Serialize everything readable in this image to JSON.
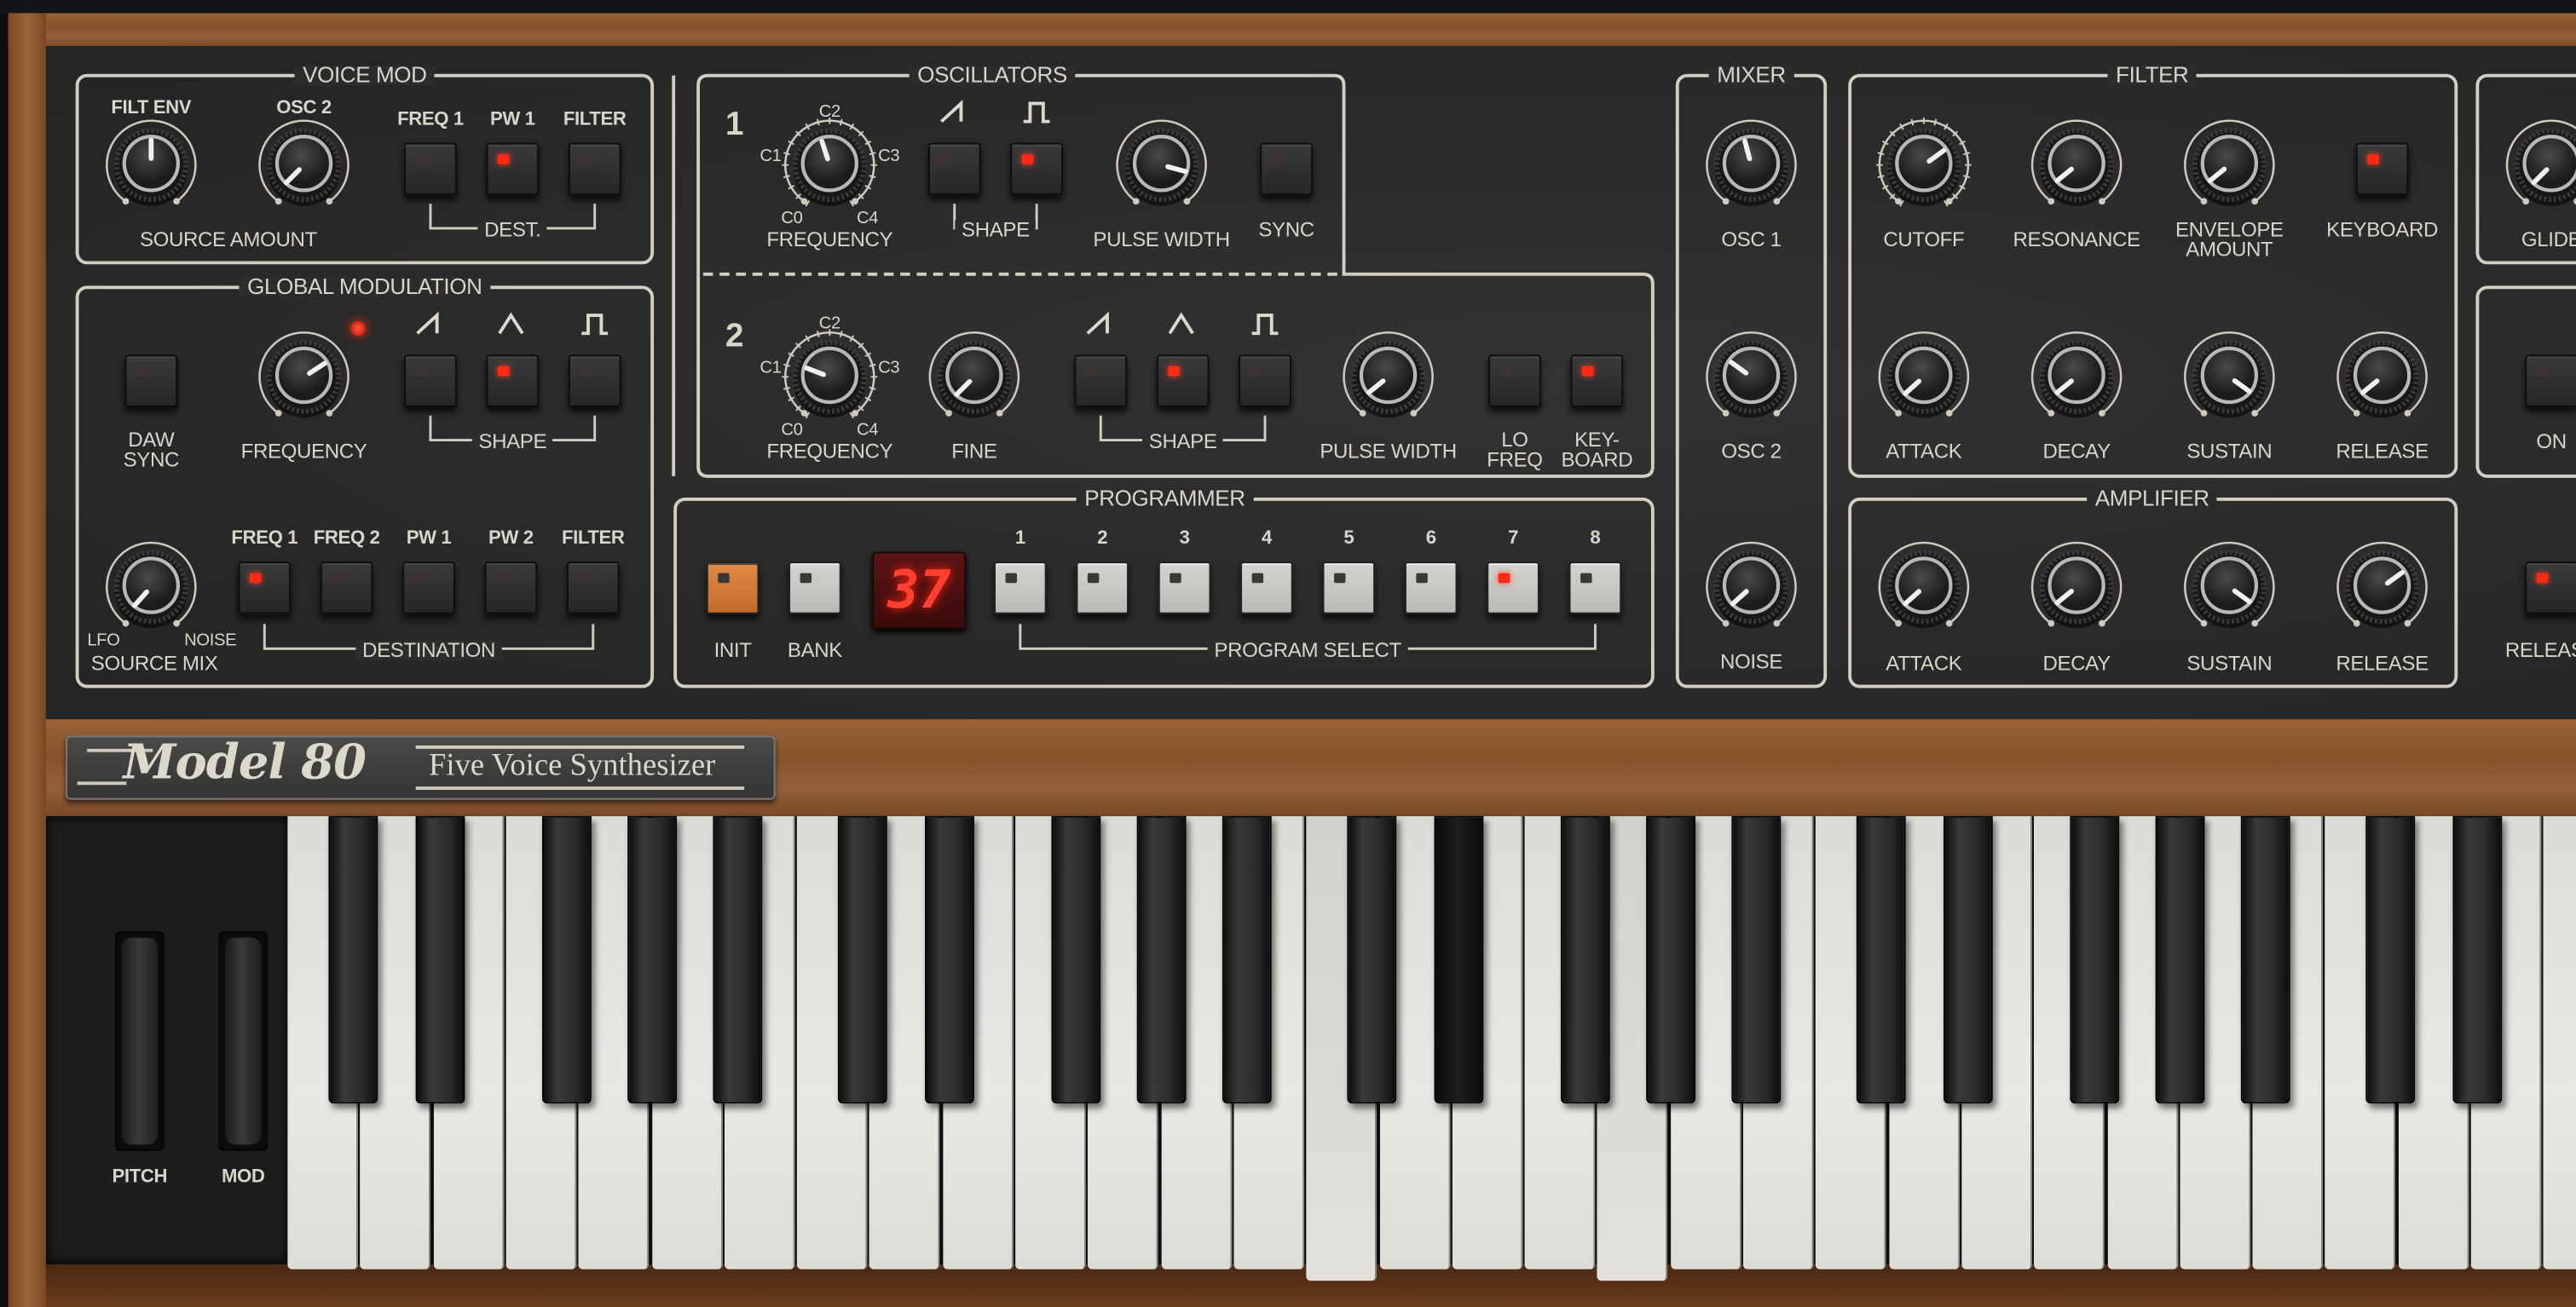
{
  "colors": {
    "panel": "#2c2c2c",
    "legend": "#dcd8cc",
    "led_on": "#ff2a14",
    "led_off": "#3f3331",
    "wood": "#8c5a30",
    "init_button": "#d07a35",
    "display": "#ff4030"
  },
  "voice_mod": {
    "title": "VOICE MOD",
    "filt_env": {
      "label": "FILT ENV",
      "value": 0.5
    },
    "osc2": {
      "label": "OSC 2",
      "value": 0.05
    },
    "caption": "SOURCE AMOUNT",
    "dest_caption": "DEST.",
    "dest": [
      {
        "label": "FREQ 1",
        "on": false
      },
      {
        "label": "PW 1",
        "on": true
      },
      {
        "label": "FILTER",
        "on": false
      }
    ]
  },
  "global_mod": {
    "title": "GLOBAL MODULATION",
    "daw_sync": {
      "label": "DAW\nSYNC",
      "on": false
    },
    "frequency": {
      "label": "FREQUENCY",
      "value": 0.69
    },
    "lfo_led_on": true,
    "shape_caption": "SHAPE",
    "shapes": [
      {
        "icon": "saw-wave-icon",
        "on": false
      },
      {
        "icon": "triangle-wave-icon",
        "on": true
      },
      {
        "icon": "square-wave-icon",
        "on": false
      }
    ],
    "source_mix": {
      "label": "SOURCE MIX",
      "left": "LFO",
      "right": "NOISE",
      "value": 0.04
    },
    "dest_caption": "DESTINATION",
    "dest": [
      {
        "label": "FREQ 1",
        "on": true
      },
      {
        "label": "FREQ 2",
        "on": false
      },
      {
        "label": "PW 1",
        "on": false
      },
      {
        "label": "PW 2",
        "on": false
      },
      {
        "label": "FILTER",
        "on": false
      }
    ]
  },
  "oscillators": {
    "title": "OSCILLATORS",
    "freq_scale": [
      "C0",
      "C1",
      "C2",
      "C3",
      "C4"
    ],
    "osc1": {
      "number": "1",
      "frequency": {
        "label": "FREQUENCY",
        "value": 0.44
      },
      "shape_caption": "SHAPE",
      "shapes": [
        {
          "icon": "saw-wave-icon",
          "on": false
        },
        {
          "icon": "square-wave-icon",
          "on": true
        }
      ],
      "pulse_width": {
        "label": "PULSE WIDTH",
        "value": 0.85
      },
      "sync": {
        "label": "SYNC",
        "on": false
      }
    },
    "osc2": {
      "number": "2",
      "frequency": {
        "label": "FREQUENCY",
        "value": 0.27
      },
      "fine": {
        "label": "FINE",
        "value": 0.05
      },
      "shape_caption": "SHAPE",
      "shapes": [
        {
          "icon": "saw-wave-icon",
          "on": false
        },
        {
          "icon": "triangle-wave-icon",
          "on": true
        },
        {
          "icon": "square-wave-icon",
          "on": false
        }
      ],
      "pulse_width": {
        "label": "PULSE WIDTH",
        "value": 0.07
      },
      "lo_freq": {
        "label": "LO\nFREQ",
        "on": false
      },
      "keyboard": {
        "label": "KEY-\nBOARD",
        "on": true
      }
    }
  },
  "programmer": {
    "title": "PROGRAMMER",
    "init": {
      "label": "INIT",
      "on": false
    },
    "bank": {
      "label": "BANK",
      "on": false
    },
    "display": "37",
    "caption": "PROGRAM SELECT",
    "programs": [
      {
        "label": "1",
        "on": false
      },
      {
        "label": "2",
        "on": false
      },
      {
        "label": "3",
        "on": false
      },
      {
        "label": "4",
        "on": false
      },
      {
        "label": "5",
        "on": false
      },
      {
        "label": "6",
        "on": false
      },
      {
        "label": "7",
        "on": true
      },
      {
        "label": "8",
        "on": false
      }
    ]
  },
  "mixer": {
    "title": "MIXER",
    "knobs": [
      {
        "label": "OSC 1",
        "value": 0.45
      },
      {
        "label": "OSC 2",
        "value": 0.32
      },
      {
        "label": "NOISE",
        "value": 0.06
      }
    ]
  },
  "filter": {
    "title": "FILTER",
    "cutoff": {
      "label": "CUTOFF",
      "value": 0.68
    },
    "resonance": {
      "label": "RESONANCE",
      "value": 0.07
    },
    "envelope_amount": {
      "label": "ENVELOPE\nAMOUNT",
      "value": 0.07
    },
    "keyboard": {
      "label": "KEYBOARD",
      "on": true
    },
    "envelope": [
      {
        "label": "ATTACK",
        "value": 0.06
      },
      {
        "label": "DECAY",
        "value": 0.07
      },
      {
        "label": "SUSTAIN",
        "value": 0.92
      },
      {
        "label": "RELEASE",
        "value": 0.07
      }
    ]
  },
  "amplifier": {
    "title": "AMPLIFIER",
    "envelope": [
      {
        "label": "ATTACK",
        "value": 0.06
      },
      {
        "label": "DECAY",
        "value": 0.07
      },
      {
        "label": "SUSTAIN",
        "value": 0.92
      },
      {
        "label": "RELEASE",
        "value": 0.68
      }
    ]
  },
  "right_edge": {
    "glide": {
      "label": "GLIDE",
      "value": 0.05
    },
    "on": {
      "label": "ON",
      "on": false
    },
    "release": {
      "label": "RELEASE",
      "on": true
    }
  },
  "badge": {
    "model": "Model 80",
    "subtitle": "Five Voice Synthesizer"
  },
  "wheels": {
    "pitch": {
      "label": "PITCH",
      "value": 0.5
    },
    "mod": {
      "label": "MOD",
      "value": 0.0
    }
  },
  "keyboard": {
    "pressed_keys": [
      "C3",
      "D#3",
      "G3"
    ]
  }
}
